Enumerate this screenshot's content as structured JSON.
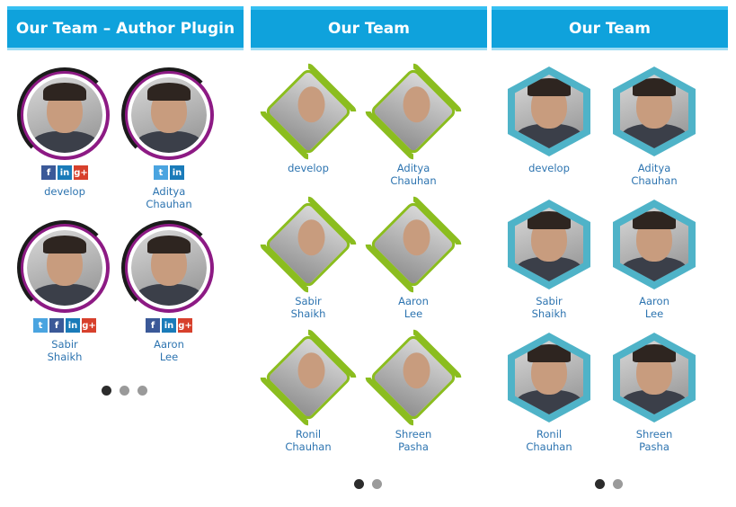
{
  "widgets": [
    {
      "title": "Our Team – Author Plugin",
      "style": "circle",
      "members": [
        {
          "name": "develop",
          "social": [
            "facebook-icon",
            "linkedin-icon",
            "googleplus-icon"
          ]
        },
        {
          "name": "Aditya\nChauhan",
          "social": [
            "twitter-icon",
            "linkedin-icon"
          ]
        },
        {
          "name": "Sabir\nShaikh",
          "social": [
            "twitter-icon",
            "facebook-icon",
            "linkedin-icon",
            "googleplus-icon"
          ]
        },
        {
          "name": "Aaron\nLee",
          "social": [
            "facebook-icon",
            "linkedin-icon",
            "googleplus-icon"
          ]
        }
      ],
      "pagination": {
        "pages": 3,
        "active": 1
      }
    },
    {
      "title": "Our Team",
      "style": "diamond",
      "members": [
        {
          "name": "develop"
        },
        {
          "name": "Aditya\nChauhan"
        },
        {
          "name": "Sabir\nShaikh"
        },
        {
          "name": "Aaron\nLee"
        },
        {
          "name": "Ronil\nChauhan"
        },
        {
          "name": "Shreen\nPasha"
        }
      ],
      "pagination": {
        "pages": 2,
        "active": 1
      }
    },
    {
      "title": "Our Team",
      "style": "hexagon",
      "members": [
        {
          "name": "develop"
        },
        {
          "name": "Aditya\nChauhan"
        },
        {
          "name": "Sabir\nShaikh"
        },
        {
          "name": "Aaron\nLee"
        },
        {
          "name": "Ronil\nChauhan"
        },
        {
          "name": "Shreen\nPasha"
        }
      ],
      "pagination": {
        "pages": 2,
        "active": 1
      }
    }
  ],
  "colors": {
    "header_bg": "#0fa2dc",
    "circle_ring": "#8d1a84",
    "diamond_ring": "#8bbd1f",
    "hex_ring": "#4fb3c8",
    "name_link": "#2d74b0"
  },
  "social_glyphs": {
    "facebook-icon": "f",
    "linkedin-icon": "in",
    "googleplus-icon": "g+",
    "twitter-icon": "t"
  }
}
